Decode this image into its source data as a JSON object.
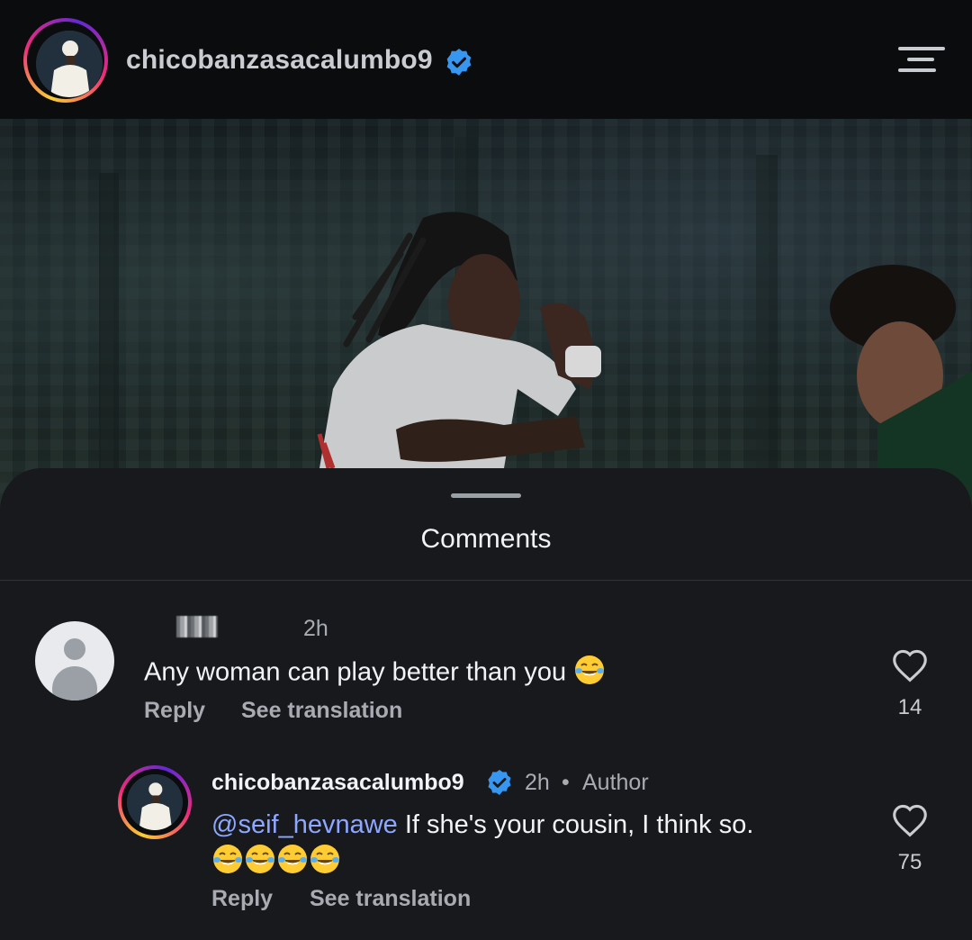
{
  "header": {
    "username": "chicobanzasacalumbo9",
    "verified": true
  },
  "sheet": {
    "title": "Comments"
  },
  "comments": [
    {
      "author_redacted": true,
      "time": "2h",
      "text": "Any woman can play better than you",
      "emoji": "face-with-tears-of-joy",
      "reply_label": "Reply",
      "translate_label": "See translation",
      "likes": "14"
    },
    {
      "author": "chicobanzasacalumbo9",
      "verified": true,
      "time": "2h",
      "separator": "•",
      "author_badge": "Author",
      "mention": "@seif_hevnawe",
      "text": " If she's your cousin, I think so.",
      "emoji_count": 4,
      "emoji": "face-with-tears-of-joy",
      "reply_label": "Reply",
      "translate_label": "See translation",
      "likes": "75"
    }
  ],
  "colors": {
    "verified_blue": "#3797f0",
    "mention": "#8ea7ff",
    "sheet_bg": "#17191c"
  }
}
